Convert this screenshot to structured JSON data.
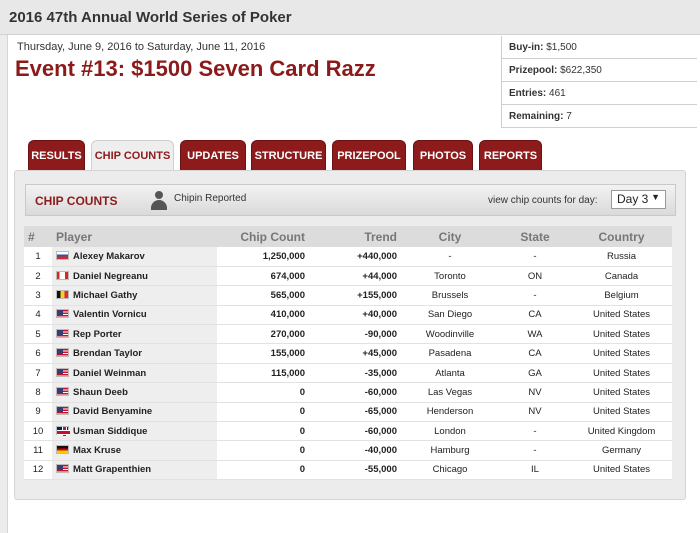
{
  "site_title": "2016 47th Annual World Series of Poker",
  "event": {
    "dates": "Thursday, June 9, 2016 to Saturday, June 11, 2016",
    "title": "Event #13: $1500 Seven Card Razz"
  },
  "info": [
    {
      "label": "Buy-in:",
      "value": "$1,500"
    },
    {
      "label": "Prizepool:",
      "value": "$622,350"
    },
    {
      "label": "Entries:",
      "value": "461"
    },
    {
      "label": "Remaining:",
      "value": "7"
    }
  ],
  "tabs": [
    "RESULTS",
    "CHIP COUNTS",
    "UPDATES",
    "STRUCTURE",
    "PRIZEPOOL",
    "PHOTOS",
    "REPORTS"
  ],
  "active_tab": "CHIP COUNTS",
  "panel": {
    "title": "CHIP COUNTS",
    "reported_label": "Chipin Reported",
    "day_label": "view chip counts for day:",
    "day_value": "Day 3"
  },
  "table": {
    "headers": [
      "#",
      "Player",
      "Chip Count",
      "Trend",
      "City",
      "State",
      "Country"
    ],
    "rows": [
      {
        "num": "1",
        "flag": "ru",
        "player": "Alexey Makarov",
        "chips": "1,250,000",
        "trend": "+440,000",
        "city": "-",
        "state": "-",
        "country": "Russia"
      },
      {
        "num": "2",
        "flag": "ca",
        "player": "Daniel Negreanu",
        "chips": "674,000",
        "trend": "+44,000",
        "city": "Toronto",
        "state": "ON",
        "country": "Canada"
      },
      {
        "num": "3",
        "flag": "be",
        "player": "Michael Gathy",
        "chips": "565,000",
        "trend": "+155,000",
        "city": "Brussels",
        "state": "-",
        "country": "Belgium"
      },
      {
        "num": "4",
        "flag": "us",
        "player": "Valentin Vornicu",
        "chips": "410,000",
        "trend": "+40,000",
        "city": "San Diego",
        "state": "CA",
        "country": "United States"
      },
      {
        "num": "5",
        "flag": "us",
        "player": "Rep Porter",
        "chips": "270,000",
        "trend": "-90,000",
        "city": "Woodinville",
        "state": "WA",
        "country": "United States"
      },
      {
        "num": "6",
        "flag": "us",
        "player": "Brendan Taylor",
        "chips": "155,000",
        "trend": "+45,000",
        "city": "Pasadena",
        "state": "CA",
        "country": "United States"
      },
      {
        "num": "7",
        "flag": "us",
        "player": "Daniel Weinman",
        "chips": "115,000",
        "trend": "-35,000",
        "city": "Atlanta",
        "state": "GA",
        "country": "United States"
      },
      {
        "num": "8",
        "flag": "us",
        "player": "Shaun Deeb",
        "chips": "0",
        "trend": "-60,000",
        "city": "Las Vegas",
        "state": "NV",
        "country": "United States"
      },
      {
        "num": "9",
        "flag": "us",
        "player": "David Benyamine",
        "chips": "0",
        "trend": "-65,000",
        "city": "Henderson",
        "state": "NV",
        "country": "United States"
      },
      {
        "num": "10",
        "flag": "gb",
        "player": "Usman Siddique",
        "chips": "0",
        "trend": "-60,000",
        "city": "London",
        "state": "-",
        "country": "United Kingdom"
      },
      {
        "num": "11",
        "flag": "de",
        "player": "Max Kruse",
        "chips": "0",
        "trend": "-40,000",
        "city": "Hamburg",
        "state": "-",
        "country": "Germany"
      },
      {
        "num": "12",
        "flag": "us",
        "player": "Matt Grapenthien",
        "chips": "0",
        "trend": "-55,000",
        "city": "Chicago",
        "state": "IL",
        "country": "United States"
      }
    ]
  },
  "colors": {
    "brand": "#8e1b1b",
    "positive": "#2e8b2e",
    "negative": "#cc2222"
  }
}
